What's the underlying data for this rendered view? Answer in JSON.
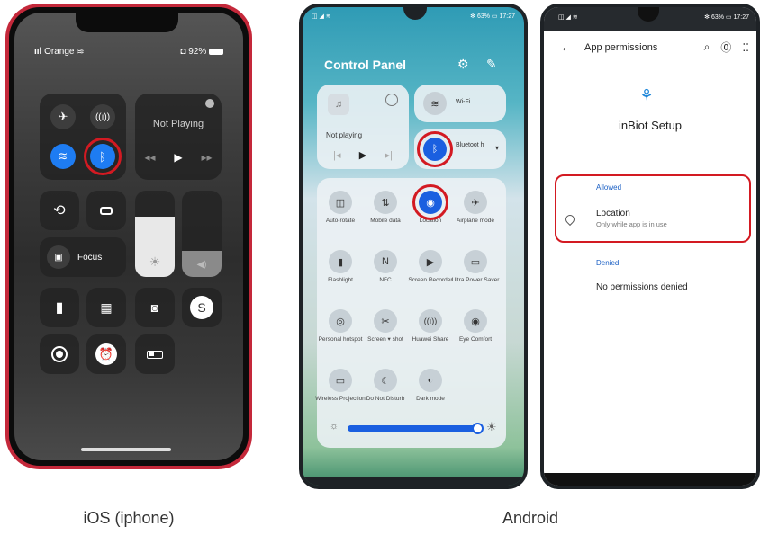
{
  "ios": {
    "carrier": "Orange",
    "battery": "92%",
    "now_playing": "Not Playing",
    "focus_label": "Focus",
    "caption": "iOS (iphone)"
  },
  "android": {
    "caption": "Android",
    "panel": {
      "time_status": "63%",
      "time": "17:27",
      "title": "Control Panel",
      "media_status": "Not playing",
      "wifi_label": "Wi-Fi",
      "bluetooth_label": "Bluetoot h",
      "tiles": [
        {
          "label": "Auto-rotate",
          "icon": "rotate-icon"
        },
        {
          "label": "Mobile data",
          "icon": "mobile-data-icon"
        },
        {
          "label": "Location",
          "icon": "location-icon"
        },
        {
          "label": "Airplane mode",
          "icon": "airplane-icon"
        },
        {
          "label": "Flashlight",
          "icon": "flashlight-icon"
        },
        {
          "label": "NFC",
          "icon": "nfc-icon"
        },
        {
          "label": "Screen Recorder",
          "icon": "screen-recorder-icon"
        },
        {
          "label": "Ultra Power Saver",
          "icon": "battery-saver-icon"
        },
        {
          "label": "Personal hotspot",
          "icon": "hotspot-icon"
        },
        {
          "label": "Screen ▾ shot",
          "icon": "screenshot-icon"
        },
        {
          "label": "Huawei Share",
          "icon": "share-icon"
        },
        {
          "label": "Eye Comfort",
          "icon": "eye-icon"
        },
        {
          "label": "Wireless Projection",
          "icon": "projection-icon"
        },
        {
          "label": "Do Not Disturb",
          "icon": "moon-icon"
        },
        {
          "label": "Dark mode",
          "icon": "dark-mode-icon"
        }
      ],
      "brightness": 0.95
    },
    "permissions": {
      "status_battery": "63%",
      "status_time": "17:27",
      "title": "App permissions",
      "app_name": "inBiot Setup",
      "allowed_header": "Allowed",
      "allowed_item": "Location",
      "allowed_sub": "Only while app is in use",
      "denied_header": "Denied",
      "denied_text": "No permissions denied"
    }
  }
}
